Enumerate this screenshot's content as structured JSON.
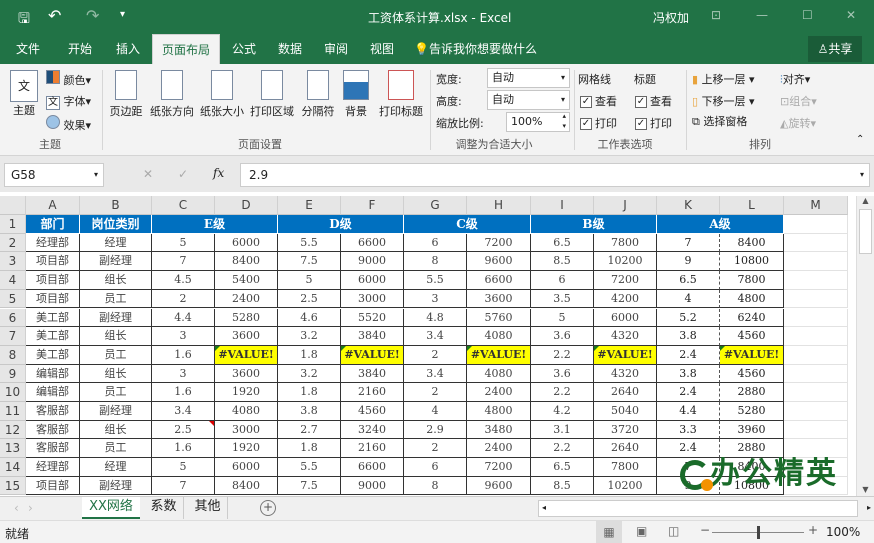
{
  "titlebar": {
    "title": "工资体系计算.xlsx - Excel",
    "user": "冯权加",
    "min": "—",
    "max": "☐",
    "close": "✕",
    "ribbon_display": "⊡",
    "undo": "↶",
    "redo": "↷",
    "qat_more": "▾"
  },
  "tabs": [
    {
      "label": "文件"
    },
    {
      "label": "开始"
    },
    {
      "label": "插入"
    },
    {
      "label": "页面布局",
      "active": true
    },
    {
      "label": "公式"
    },
    {
      "label": "数据"
    },
    {
      "label": "审阅"
    },
    {
      "label": "视图"
    }
  ],
  "tell_me": "告诉我你想要做什么",
  "share": "共享",
  "ribbon": {
    "theme": {
      "themes": "主题",
      "colors": "颜色",
      "fonts": "字体",
      "effects": "效果",
      "group": "主题"
    },
    "page_setup": {
      "margins": "页边距",
      "orientation": "纸张方向",
      "size": "纸张大小",
      "print_area": "打印区域",
      "breaks": "分隔符",
      "background": "背景",
      "print_titles": "打印标题",
      "group": "页面设置"
    },
    "scale": {
      "width_label": "宽度:",
      "width_value": "自动",
      "height_label": "高度:",
      "height_value": "自动",
      "scale_label": "缩放比例:",
      "scale_value": "100%",
      "group": "调整为合适大小"
    },
    "sheet_options": {
      "gridlines": "网格线",
      "headings": "标题",
      "view": "查看",
      "print": "打印",
      "gridlines_view": true,
      "gridlines_print": true,
      "headings_view": true,
      "headings_print": true,
      "group": "工作表选项"
    },
    "arrange": {
      "bring_forward": "上移一层",
      "send_backward": "下移一层",
      "selection_pane": "选择窗格",
      "align": "对齐",
      "group_btn": "组合",
      "rotate": "旋转",
      "group": "排列"
    }
  },
  "formula_bar": {
    "name_box": "G58",
    "value": "2.9",
    "cancel": "✕",
    "enter": "✓",
    "fx": "fx"
  },
  "columns": [
    "A",
    "B",
    "C",
    "D",
    "E",
    "F",
    "G",
    "H",
    "I",
    "J",
    "K",
    "L",
    "M"
  ],
  "header_row": {
    "dept": "部门",
    "position": "岗位类别",
    "levels": [
      "E级",
      "D级",
      "C级",
      "B级",
      "A级"
    ]
  },
  "rows": [
    [
      "经理部",
      "经理",
      "5",
      "6000",
      "5.5",
      "6600",
      "6",
      "7200",
      "6.5",
      "7800",
      "7",
      "8400"
    ],
    [
      "项目部",
      "副经理",
      "7",
      "8400",
      "7.5",
      "9000",
      "8",
      "9600",
      "8.5",
      "10200",
      "9",
      "10800"
    ],
    [
      "项目部",
      "组长",
      "4.5",
      "5400",
      "5",
      "6000",
      "5.5",
      "6600",
      "6",
      "7200",
      "6.5",
      "7800"
    ],
    [
      "项目部",
      "员工",
      "2",
      "2400",
      "2.5",
      "3000",
      "3",
      "3600",
      "3.5",
      "4200",
      "4",
      "4800"
    ],
    [
      "美工部",
      "副经理",
      "4.4",
      "5280",
      "4.6",
      "5520",
      "4.8",
      "5760",
      "5",
      "6000",
      "5.2",
      "6240"
    ],
    [
      "美工部",
      "组长",
      "3",
      "3600",
      "3.2",
      "3840",
      "3.4",
      "4080",
      "3.6",
      "4320",
      "3.8",
      "4560"
    ],
    [
      "美工部",
      "员工",
      "1.6",
      "#VALUE!",
      "1.8",
      "#VALUE!",
      "2",
      "#VALUE!",
      "2.2",
      "#VALUE!",
      "2.4",
      "#VALUE!"
    ],
    [
      "编辑部",
      "组长",
      "3",
      "3600",
      "3.2",
      "3840",
      "3.4",
      "4080",
      "3.6",
      "4320",
      "3.8",
      "4560"
    ],
    [
      "编辑部",
      "员工",
      "1.6",
      "1920",
      "1.8",
      "2160",
      "2",
      "2400",
      "2.2",
      "2640",
      "2.4",
      "2880"
    ],
    [
      "客服部",
      "副经理",
      "3.4",
      "4080",
      "3.8",
      "4560",
      "4",
      "4800",
      "4.2",
      "5040",
      "4.4",
      "5280"
    ],
    [
      "客服部",
      "组长",
      "2.5",
      "3000",
      "2.7",
      "3240",
      "2.9",
      "3480",
      "3.1",
      "3720",
      "3.3",
      "3960"
    ],
    [
      "客服部",
      "员工",
      "1.6",
      "1920",
      "1.8",
      "2160",
      "2",
      "2400",
      "2.2",
      "2640",
      "2.4",
      "2880"
    ],
    [
      "经理部",
      "经理",
      "5",
      "6000",
      "5.5",
      "6600",
      "6",
      "7200",
      "6.5",
      "7800",
      "7",
      "8400"
    ],
    [
      "项目部",
      "副经理",
      "7",
      "8400",
      "7.5",
      "9000",
      "8",
      "9600",
      "8.5",
      "10200",
      "9",
      "10800"
    ]
  ],
  "watermark": "办公精英",
  "sheets": [
    {
      "label": "XX网络",
      "active": true
    },
    {
      "label": "系数"
    },
    {
      "label": "其他"
    }
  ],
  "add_sheet": "+",
  "status": {
    "ready": "就绪",
    "zoom": "100%",
    "zoom_level": 100
  },
  "colors": {
    "green": "#217346",
    "header_blue": "#0070c0",
    "error_yellow": "#ffff00"
  }
}
